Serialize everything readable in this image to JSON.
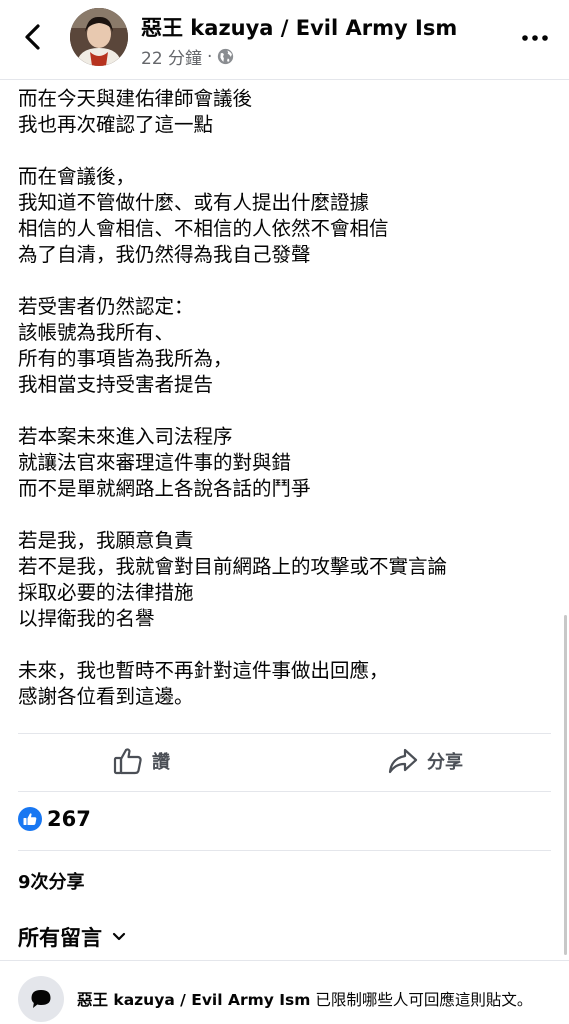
{
  "header": {
    "author": "惡王 kazuya / Evil Army Ism",
    "time": "22 分鐘",
    "separator": "·",
    "audience_icon": "globe-icon",
    "back_icon": "chevron-left-icon",
    "more_icon": "more-horizontal-icon"
  },
  "post": {
    "paragraphs": [
      [
        "而在今天與建佑律師會議後",
        "我也再次確認了這一點"
      ],
      [
        "而在會議後，",
        "我知道不管做什麼、或有人提出什麼證據",
        "相信的人會相信、不相信的人依然不會相信",
        "為了自清，我仍然得為我自己發聲"
      ],
      [
        "若受害者仍然認定：",
        "該帳號為我所有、",
        "所有的事項皆為我所為，",
        "我相當支持受害者提告"
      ],
      [
        "若本案未來進入司法程序",
        "就讓法官來審理這件事的對與錯",
        "而不是單就網路上各說各話的鬥爭"
      ],
      [
        "若是我，我願意負責",
        "若不是我，我就會對目前網路上的攻擊或不實言論",
        "採取必要的法律措施",
        "以捍衛我的名譽"
      ],
      [
        "未來，我也暫時不再針對這件事做出回應，",
        "感謝各位看到這邊。"
      ]
    ]
  },
  "actions": {
    "like_label": "讚",
    "share_label": "分享"
  },
  "stats": {
    "reaction_count": "267",
    "shares_text": "9次分享"
  },
  "comments": {
    "filter_label": "所有留言"
  },
  "notice": {
    "author": "惡王 kazuya / Evil Army Ism",
    "text": " 已限制哪些人可回應這則貼文。"
  },
  "colors": {
    "brand_blue": "#1877f2",
    "secondary_text": "#65676b",
    "divider": "#e4e6eb"
  }
}
